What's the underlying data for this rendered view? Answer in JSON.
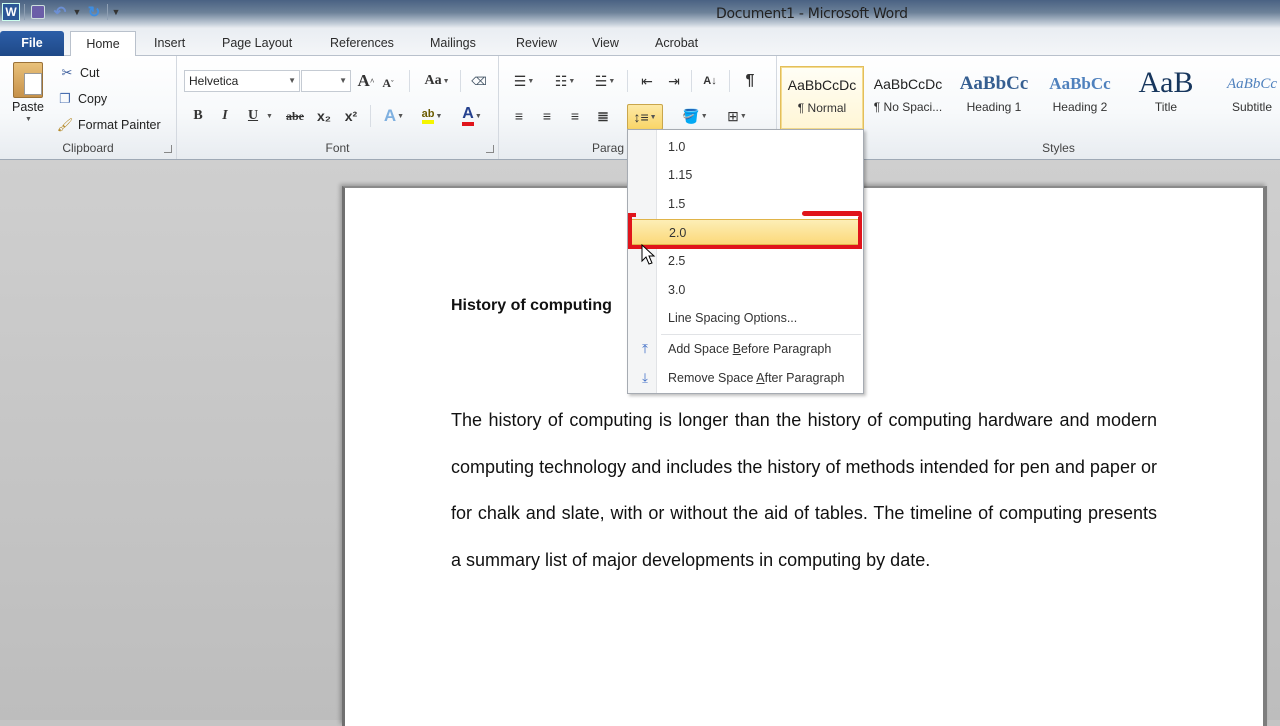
{
  "window": {
    "title": "Document1 - Microsoft Word"
  },
  "quick_access": {
    "app_icon": "word-logo-icon",
    "items": [
      "save-icon",
      "undo-icon",
      "undo-dropdown-icon",
      "redo-icon",
      "customize-qat-icon"
    ]
  },
  "tabs": [
    {
      "label": "File"
    },
    {
      "label": "Home",
      "active": true
    },
    {
      "label": "Insert"
    },
    {
      "label": "Page Layout"
    },
    {
      "label": "References"
    },
    {
      "label": "Mailings"
    },
    {
      "label": "Review"
    },
    {
      "label": "View"
    },
    {
      "label": "Acrobat"
    }
  ],
  "ribbon": {
    "clipboard": {
      "label": "Clipboard",
      "paste": "Paste",
      "cut": "Cut",
      "copy": "Copy",
      "format_painter": "Format Painter"
    },
    "font": {
      "label": "Font",
      "font_name": "Helvetica",
      "font_size": "",
      "buttons": [
        "grow-font",
        "shrink-font",
        "change-case",
        "clear-formatting",
        "bold",
        "italic",
        "underline",
        "strikethrough",
        "subscript",
        "superscript",
        "text-effects",
        "highlight",
        "font-color"
      ],
      "glyphs": {
        "bold": "B",
        "italic": "I",
        "underline": "U",
        "strike": "abe",
        "sub": "x₂",
        "sup": "x²",
        "grow": "A",
        "shrink": "A",
        "case": "Aa",
        "effects": "A",
        "highlight": "ab",
        "color": "A"
      },
      "highlight_color": "#f5f500",
      "font_color": "#e0141b"
    },
    "paragraph": {
      "label": "Paragraph",
      "label_visible": "Parag",
      "show_marks_glyph": "¶"
    },
    "styles": {
      "label": "Styles",
      "items": [
        {
          "preview": "AaBbCcDc",
          "name": "¶ Normal",
          "selected": true
        },
        {
          "preview": "AaBbCcDc",
          "name": "¶ No Spaci..."
        },
        {
          "preview": "AaBbCc",
          "name": "Heading 1"
        },
        {
          "preview": "AaBbCc",
          "name": "Heading 2"
        },
        {
          "preview": "AaB",
          "name": "Title"
        },
        {
          "preview": "AaBbCc",
          "name": "Subtitle"
        }
      ]
    }
  },
  "line_spacing_menu": {
    "options": [
      "1.0",
      "1.15",
      "1.5",
      "2.0",
      "2.5",
      "3.0"
    ],
    "highlighted": "2.0",
    "options_link": "Line Spacing Options...",
    "add_space_before": {
      "pre": "Add Space ",
      "key": "B",
      "post": "efore Paragraph"
    },
    "remove_space_after": {
      "pre": "Remove Space ",
      "key": "A",
      "post": "fter Paragraph"
    }
  },
  "document": {
    "heading": "History of computing",
    "body": "The history of computing is longer than the history of computing hardware and modern computing technology and includes the history of methods intended for pen and paper or for chalk and slate, with or without the aid of tables. The timeline of computing presents a summary list of major developments in computing by date."
  },
  "annotation": {
    "highlight_color": "#e0141b"
  }
}
